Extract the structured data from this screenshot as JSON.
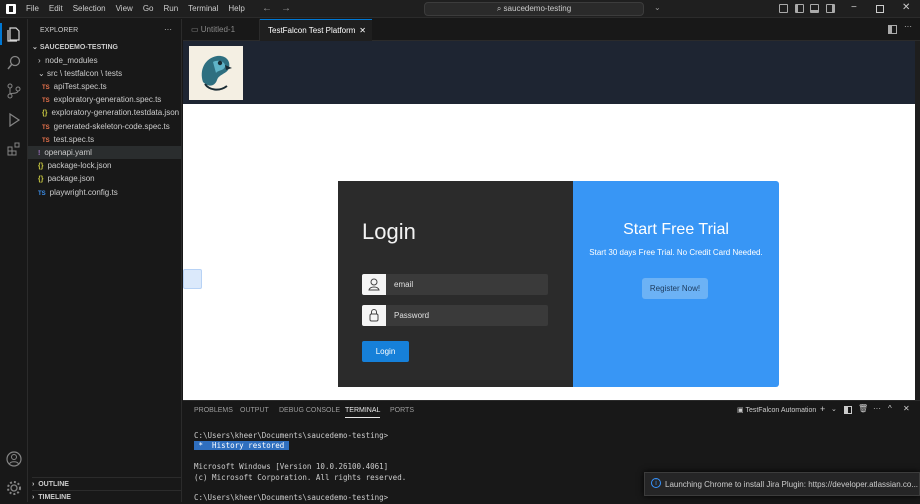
{
  "menu": [
    "File",
    "Edit",
    "Selection",
    "View",
    "Go",
    "Run",
    "Terminal",
    "Help"
  ],
  "search": "saucedemo-testing",
  "explorer": {
    "title": "EXPLORER",
    "project": "SAUCEDEMO-TESTING",
    "node_modules": "node_modules",
    "src": "src \\ testfalcon \\ tests",
    "files": [
      {
        "kind": "TS",
        "name": "apiTest.spec.ts"
      },
      {
        "kind": "TS",
        "name": "exploratory-generation.spec.ts"
      },
      {
        "kind": "{}",
        "name": "exploratory-generation.testdata.json"
      },
      {
        "kind": "TS",
        "name": "generated-skeleton-code.spec.ts"
      },
      {
        "kind": "TS",
        "name": "test.spec.ts"
      }
    ],
    "root_files": [
      {
        "kind": "!",
        "name": "openapi.yaml"
      },
      {
        "kind": "{}",
        "name": "package-lock.json"
      },
      {
        "kind": "{}",
        "name": "package.json"
      },
      {
        "kind": "TS",
        "name": "playwright.config.ts"
      }
    ],
    "outline": "OUTLINE",
    "timeline": "TIMELINE"
  },
  "tabs": [
    {
      "label": "Untitled-1"
    },
    {
      "label": "TestFalcon Test Platform"
    }
  ],
  "login": {
    "title": "Login",
    "email": "email",
    "password": "Password",
    "button": "Login"
  },
  "trial": {
    "title": "Start Free Trial",
    "subtitle": "Start 30 days Free Trial. No Credit Card Needed.",
    "button": "Register Now!"
  },
  "panel": {
    "tabs": [
      "PROBLEMS",
      "OUTPUT",
      "DEBUG CONSOLE",
      "TERMINAL",
      "PORTS"
    ],
    "terminal_name": "TestFalcon Automation",
    "lines": [
      "C:\\Users\\kheer\\Documents\\saucedemo-testing>",
      "Microsoft Windows [Version 10.0.26100.4061]",
      "(c) Microsoft Corporation. All rights reserved.",
      "C:\\Users\\kheer\\Documents\\saucedemo-testing>"
    ],
    "history": " *  History restored "
  },
  "toast": "Launching Chrome to install Jira Plugin: https://developer.atlassian.co..."
}
